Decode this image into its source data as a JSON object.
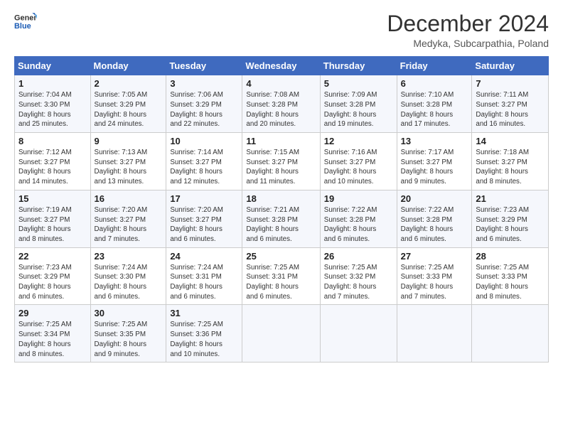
{
  "logo": {
    "line1": "General",
    "line2": "Blue"
  },
  "title": "December 2024",
  "subtitle": "Medyka, Subcarpathia, Poland",
  "days_header": [
    "Sunday",
    "Monday",
    "Tuesday",
    "Wednesday",
    "Thursday",
    "Friday",
    "Saturday"
  ],
  "weeks": [
    [
      {
        "day": "1",
        "info": "Sunrise: 7:04 AM\nSunset: 3:30 PM\nDaylight: 8 hours\nand 25 minutes."
      },
      {
        "day": "2",
        "info": "Sunrise: 7:05 AM\nSunset: 3:29 PM\nDaylight: 8 hours\nand 24 minutes."
      },
      {
        "day": "3",
        "info": "Sunrise: 7:06 AM\nSunset: 3:29 PM\nDaylight: 8 hours\nand 22 minutes."
      },
      {
        "day": "4",
        "info": "Sunrise: 7:08 AM\nSunset: 3:28 PM\nDaylight: 8 hours\nand 20 minutes."
      },
      {
        "day": "5",
        "info": "Sunrise: 7:09 AM\nSunset: 3:28 PM\nDaylight: 8 hours\nand 19 minutes."
      },
      {
        "day": "6",
        "info": "Sunrise: 7:10 AM\nSunset: 3:28 PM\nDaylight: 8 hours\nand 17 minutes."
      },
      {
        "day": "7",
        "info": "Sunrise: 7:11 AM\nSunset: 3:27 PM\nDaylight: 8 hours\nand 16 minutes."
      }
    ],
    [
      {
        "day": "8",
        "info": "Sunrise: 7:12 AM\nSunset: 3:27 PM\nDaylight: 8 hours\nand 14 minutes."
      },
      {
        "day": "9",
        "info": "Sunrise: 7:13 AM\nSunset: 3:27 PM\nDaylight: 8 hours\nand 13 minutes."
      },
      {
        "day": "10",
        "info": "Sunrise: 7:14 AM\nSunset: 3:27 PM\nDaylight: 8 hours\nand 12 minutes."
      },
      {
        "day": "11",
        "info": "Sunrise: 7:15 AM\nSunset: 3:27 PM\nDaylight: 8 hours\nand 11 minutes."
      },
      {
        "day": "12",
        "info": "Sunrise: 7:16 AM\nSunset: 3:27 PM\nDaylight: 8 hours\nand 10 minutes."
      },
      {
        "day": "13",
        "info": "Sunrise: 7:17 AM\nSunset: 3:27 PM\nDaylight: 8 hours\nand 9 minutes."
      },
      {
        "day": "14",
        "info": "Sunrise: 7:18 AM\nSunset: 3:27 PM\nDaylight: 8 hours\nand 8 minutes."
      }
    ],
    [
      {
        "day": "15",
        "info": "Sunrise: 7:19 AM\nSunset: 3:27 PM\nDaylight: 8 hours\nand 8 minutes."
      },
      {
        "day": "16",
        "info": "Sunrise: 7:20 AM\nSunset: 3:27 PM\nDaylight: 8 hours\nand 7 minutes."
      },
      {
        "day": "17",
        "info": "Sunrise: 7:20 AM\nSunset: 3:27 PM\nDaylight: 8 hours\nand 6 minutes."
      },
      {
        "day": "18",
        "info": "Sunrise: 7:21 AM\nSunset: 3:28 PM\nDaylight: 8 hours\nand 6 minutes."
      },
      {
        "day": "19",
        "info": "Sunrise: 7:22 AM\nSunset: 3:28 PM\nDaylight: 8 hours\nand 6 minutes."
      },
      {
        "day": "20",
        "info": "Sunrise: 7:22 AM\nSunset: 3:28 PM\nDaylight: 8 hours\nand 6 minutes."
      },
      {
        "day": "21",
        "info": "Sunrise: 7:23 AM\nSunset: 3:29 PM\nDaylight: 8 hours\nand 6 minutes."
      }
    ],
    [
      {
        "day": "22",
        "info": "Sunrise: 7:23 AM\nSunset: 3:29 PM\nDaylight: 8 hours\nand 6 minutes."
      },
      {
        "day": "23",
        "info": "Sunrise: 7:24 AM\nSunset: 3:30 PM\nDaylight: 8 hours\nand 6 minutes."
      },
      {
        "day": "24",
        "info": "Sunrise: 7:24 AM\nSunset: 3:31 PM\nDaylight: 8 hours\nand 6 minutes."
      },
      {
        "day": "25",
        "info": "Sunrise: 7:25 AM\nSunset: 3:31 PM\nDaylight: 8 hours\nand 6 minutes."
      },
      {
        "day": "26",
        "info": "Sunrise: 7:25 AM\nSunset: 3:32 PM\nDaylight: 8 hours\nand 7 minutes."
      },
      {
        "day": "27",
        "info": "Sunrise: 7:25 AM\nSunset: 3:33 PM\nDaylight: 8 hours\nand 7 minutes."
      },
      {
        "day": "28",
        "info": "Sunrise: 7:25 AM\nSunset: 3:33 PM\nDaylight: 8 hours\nand 8 minutes."
      }
    ],
    [
      {
        "day": "29",
        "info": "Sunrise: 7:25 AM\nSunset: 3:34 PM\nDaylight: 8 hours\nand 8 minutes."
      },
      {
        "day": "30",
        "info": "Sunrise: 7:25 AM\nSunset: 3:35 PM\nDaylight: 8 hours\nand 9 minutes."
      },
      {
        "day": "31",
        "info": "Sunrise: 7:25 AM\nSunset: 3:36 PM\nDaylight: 8 hours\nand 10 minutes."
      },
      null,
      null,
      null,
      null
    ]
  ]
}
